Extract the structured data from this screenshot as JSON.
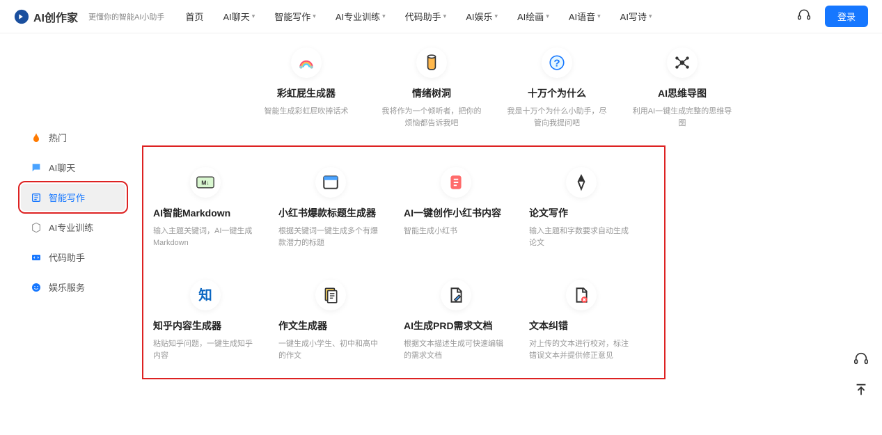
{
  "header": {
    "brand": "AI创作家",
    "tagline": "更懂你的智能AI小助手",
    "nav": [
      "首页",
      "AI聊天",
      "智能写作",
      "AI专业训练",
      "代码助手",
      "AI娱乐",
      "AI绘画",
      "AI语音",
      "AI写诗"
    ],
    "login": "登录"
  },
  "sidebar": {
    "items": [
      {
        "label": "热门"
      },
      {
        "label": "AI聊天"
      },
      {
        "label": "智能写作"
      },
      {
        "label": "AI专业训练"
      },
      {
        "label": "代码助手"
      },
      {
        "label": "娱乐服务"
      }
    ]
  },
  "top_row": [
    {
      "title": "彩虹屁生成器",
      "desc": "智能生成彩虹屁吹捧话术"
    },
    {
      "title": "情绪树洞",
      "desc": "我将作为一个倾听者，把你的烦恼都告诉我吧"
    },
    {
      "title": "十万个为什么",
      "desc": "我是十万个为什么小助手，尽管向我提问吧"
    },
    {
      "title": "AI思维导图",
      "desc": "利用AI一键生成完整的思维导图"
    }
  ],
  "grid": [
    {
      "title": "AI智能Markdown",
      "desc": "输入主题关键词，AI一键生成Markdown"
    },
    {
      "title": "小红书爆款标题生成器",
      "desc": "根据关键词一键生成多个有爆款潜力的标题"
    },
    {
      "title": "AI一键创作小红书内容",
      "desc": "智能生成小红书"
    },
    {
      "title": "论文写作",
      "desc": "输入主题和字数要求自动生成论文"
    },
    {
      "title": "知乎内容生成器",
      "desc": "粘贴知乎问题，一键生成知乎内容"
    },
    {
      "title": "作文生成器",
      "desc": "一键生成小学生、初中和高中的作文"
    },
    {
      "title": "AI生成PRD需求文档",
      "desc": "根据文本描述生成可快速编辑的需求文档"
    },
    {
      "title": "文本纠错",
      "desc": "对上传的文本进行校对，标注错误文本并提供修正意见"
    }
  ]
}
